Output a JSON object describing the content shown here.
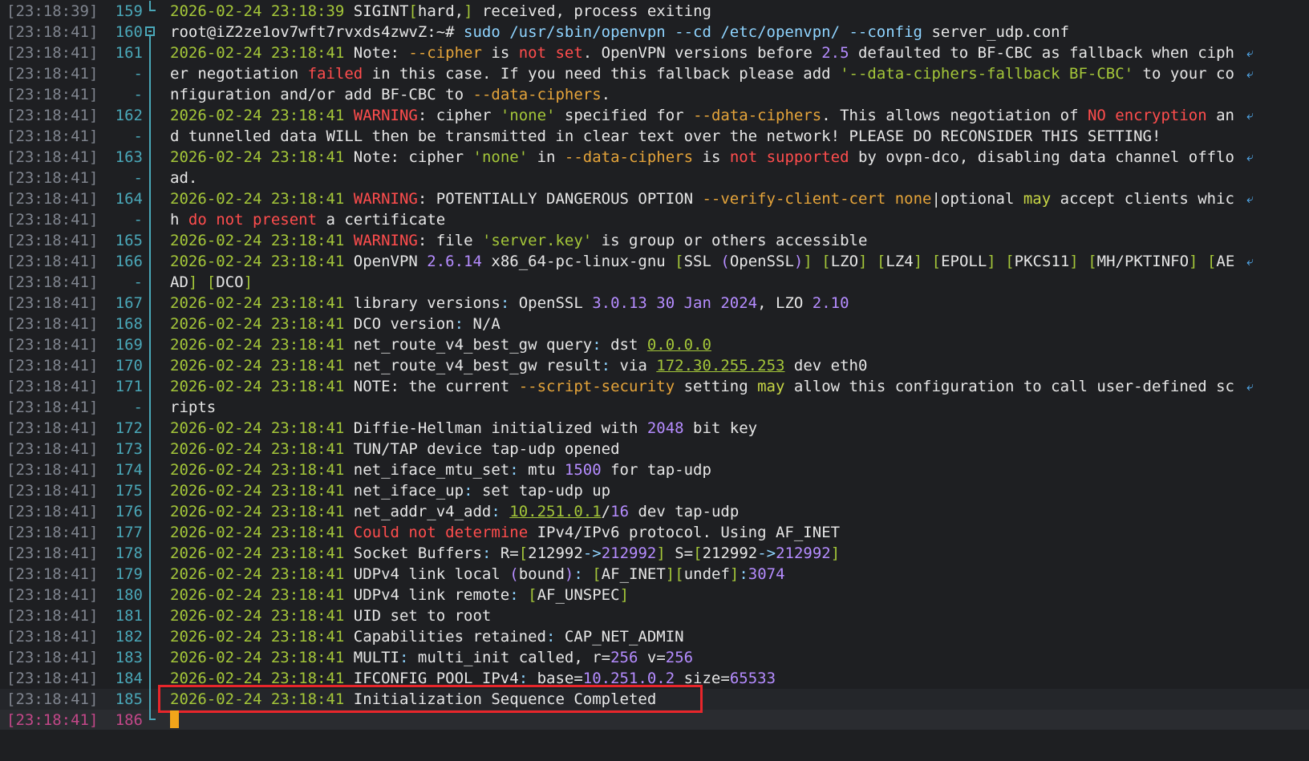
{
  "terminal": {
    "prompt_user": "root@iZ2ze1ov7wft7rvxds4zwvZ:~#",
    "rows": [
      {
        "ts": "[23:18:39]",
        "ln": "159",
        "gutter": "elbow",
        "segs": [
          [
            "date",
            "2026-02-24 23:18:39"
          ],
          [
            "plain",
            " SIGINT"
          ],
          [
            "br",
            "["
          ],
          [
            "plain",
            "hard,"
          ],
          [
            "br",
            "]"
          ],
          [
            "plain",
            " received, process exiting"
          ]
        ]
      },
      {
        "ts": "[23:18:41]",
        "ln": "160",
        "gutter": "fold",
        "segs": [
          [
            "plain",
            "root@iZ2ze1ov7wft7rvxds4zwvZ:~# "
          ],
          [
            "cmd",
            "sudo /usr/sbin/openvpn --cd /etc/openvpn/ --config"
          ],
          [
            "plain",
            " server_udp.conf"
          ]
        ]
      },
      {
        "ts": "[23:18:41]",
        "ln": "161",
        "gutter": "line",
        "wrap": true,
        "segs": [
          [
            "date",
            "2026-02-24 23:18:41"
          ],
          [
            "plain",
            " Note: "
          ],
          [
            "opt",
            "--cipher"
          ],
          [
            "plain",
            " is "
          ],
          [
            "kw",
            "not set"
          ],
          [
            "plain",
            ". OpenVPN versions before "
          ],
          [
            "num",
            "2.5"
          ],
          [
            "plain",
            " defaulted to BF-CBC as fallback when ciph"
          ]
        ]
      },
      {
        "ts": "[23:18:41]",
        "ln": "-",
        "gutter": "line",
        "wrap": true,
        "segs": [
          [
            "plain",
            "er negotiation "
          ],
          [
            "kw",
            "failed"
          ],
          [
            "plain",
            " in this case. If you need this fallback please add "
          ],
          [
            "str",
            "'--data-ciphers-fallback BF-CBC'"
          ],
          [
            "plain",
            " to your co"
          ]
        ]
      },
      {
        "ts": "[23:18:41]",
        "ln": "-",
        "gutter": "line",
        "segs": [
          [
            "plain",
            "nfiguration and/or add BF-CBC to "
          ],
          [
            "opt",
            "--data-ciphers"
          ],
          [
            "plain",
            "."
          ]
        ]
      },
      {
        "ts": "[23:18:41]",
        "ln": "162",
        "gutter": "line",
        "wrap": true,
        "segs": [
          [
            "date",
            "2026-02-24 23:18:41"
          ],
          [
            "plain",
            " "
          ],
          [
            "kw",
            "WARNING"
          ],
          [
            "plain",
            ": cipher "
          ],
          [
            "str",
            "'none'"
          ],
          [
            "plain",
            " specified for "
          ],
          [
            "opt",
            "--data-ciphers"
          ],
          [
            "plain",
            ". This allows negotiation of "
          ],
          [
            "kw",
            "NO encryption"
          ],
          [
            "plain",
            " an"
          ]
        ]
      },
      {
        "ts": "[23:18:41]",
        "ln": "-",
        "gutter": "line",
        "segs": [
          [
            "plain",
            "d tunnelled data WILL then be transmitted in clear text over the network! PLEASE DO RECONSIDER THIS SETTING!"
          ]
        ]
      },
      {
        "ts": "[23:18:41]",
        "ln": "163",
        "gutter": "line",
        "wrap": true,
        "segs": [
          [
            "date",
            "2026-02-24 23:18:41"
          ],
          [
            "plain",
            " Note: cipher "
          ],
          [
            "str",
            "'none'"
          ],
          [
            "plain",
            " in "
          ],
          [
            "opt",
            "--data-ciphers"
          ],
          [
            "plain",
            " is "
          ],
          [
            "kw",
            "not supported"
          ],
          [
            "plain",
            " by ovpn-dco, disabling data channel offlo"
          ]
        ]
      },
      {
        "ts": "[23:18:41]",
        "ln": "-",
        "gutter": "line",
        "segs": [
          [
            "plain",
            "ad."
          ]
        ]
      },
      {
        "ts": "[23:18:41]",
        "ln": "164",
        "gutter": "line",
        "wrap": true,
        "segs": [
          [
            "date",
            "2026-02-24 23:18:41"
          ],
          [
            "plain",
            " "
          ],
          [
            "kw",
            "WARNING"
          ],
          [
            "plain",
            ": POTENTIALLY DANGEROUS OPTION "
          ],
          [
            "opt",
            "--verify-client-cert none"
          ],
          [
            "plain",
            "|optional "
          ],
          [
            "yel",
            "may"
          ],
          [
            "plain",
            " accept clients whic"
          ]
        ]
      },
      {
        "ts": "[23:18:41]",
        "ln": "-",
        "gutter": "line",
        "segs": [
          [
            "plain",
            "h "
          ],
          [
            "kw",
            "do not present"
          ],
          [
            "plain",
            " a certificate"
          ]
        ]
      },
      {
        "ts": "[23:18:41]",
        "ln": "165",
        "gutter": "line",
        "segs": [
          [
            "date",
            "2026-02-24 23:18:41"
          ],
          [
            "plain",
            " "
          ],
          [
            "kw",
            "WARNING"
          ],
          [
            "plain",
            ": file "
          ],
          [
            "str",
            "'server.key'"
          ],
          [
            "plain",
            " is group or others accessible"
          ]
        ]
      },
      {
        "ts": "[23:18:41]",
        "ln": "166",
        "gutter": "line",
        "wrap": true,
        "segs": [
          [
            "date",
            "2026-02-24 23:18:41"
          ],
          [
            "plain",
            " OpenVPN "
          ],
          [
            "num",
            "2.6.14"
          ],
          [
            "plain",
            " x86_64-pc-linux-gnu "
          ],
          [
            "br",
            "["
          ],
          [
            "plain",
            "SSL "
          ],
          [
            "num",
            "("
          ],
          [
            "plain",
            "OpenSSL"
          ],
          [
            "num",
            ")"
          ],
          [
            "br",
            "]"
          ],
          [
            "plain",
            " "
          ],
          [
            "br",
            "["
          ],
          [
            "plain",
            "LZO"
          ],
          [
            "br",
            "]"
          ],
          [
            "plain",
            " "
          ],
          [
            "br",
            "["
          ],
          [
            "plain",
            "LZ4"
          ],
          [
            "br",
            "]"
          ],
          [
            "plain",
            " "
          ],
          [
            "br",
            "["
          ],
          [
            "plain",
            "EPOLL"
          ],
          [
            "br",
            "]"
          ],
          [
            "plain",
            " "
          ],
          [
            "br",
            "["
          ],
          [
            "plain",
            "PKCS11"
          ],
          [
            "br",
            "]"
          ],
          [
            "plain",
            " "
          ],
          [
            "br",
            "["
          ],
          [
            "plain",
            "MH/PKTINFO"
          ],
          [
            "br",
            "]"
          ],
          [
            "plain",
            " "
          ],
          [
            "br",
            "["
          ],
          [
            "plain",
            "AE"
          ]
        ]
      },
      {
        "ts": "[23:18:41]",
        "ln": "-",
        "gutter": "line",
        "segs": [
          [
            "plain",
            "AD"
          ],
          [
            "br",
            "]"
          ],
          [
            "plain",
            " "
          ],
          [
            "br",
            "["
          ],
          [
            "plain",
            "DCO"
          ],
          [
            "br",
            "]"
          ]
        ]
      },
      {
        "ts": "[23:18:41]",
        "ln": "167",
        "gutter": "line",
        "segs": [
          [
            "date",
            "2026-02-24 23:18:41"
          ],
          [
            "plain",
            " library versions"
          ],
          [
            "op",
            ":"
          ],
          [
            "plain",
            " OpenSSL "
          ],
          [
            "num",
            "3.0.13 30 Jan 2024"
          ],
          [
            "plain",
            ", LZO "
          ],
          [
            "num",
            "2.10"
          ]
        ]
      },
      {
        "ts": "[23:18:41]",
        "ln": "168",
        "gutter": "line",
        "segs": [
          [
            "date",
            "2026-02-24 23:18:41"
          ],
          [
            "plain",
            " DCO version"
          ],
          [
            "op",
            ":"
          ],
          [
            "plain",
            " N/A"
          ]
        ]
      },
      {
        "ts": "[23:18:41]",
        "ln": "169",
        "gutter": "line",
        "segs": [
          [
            "date",
            "2026-02-24 23:18:41"
          ],
          [
            "plain",
            " net_route_v4_best_gw query"
          ],
          [
            "op",
            ":"
          ],
          [
            "plain",
            " dst "
          ],
          [
            "ip",
            "0.0.0.0"
          ]
        ]
      },
      {
        "ts": "[23:18:41]",
        "ln": "170",
        "gutter": "line",
        "segs": [
          [
            "date",
            "2026-02-24 23:18:41"
          ],
          [
            "plain",
            " net_route_v4_best_gw result"
          ],
          [
            "op",
            ":"
          ],
          [
            "plain",
            " via "
          ],
          [
            "ip",
            "172.30.255.253"
          ],
          [
            "plain",
            " dev eth0"
          ]
        ]
      },
      {
        "ts": "[23:18:41]",
        "ln": "171",
        "gutter": "line",
        "wrap": true,
        "segs": [
          [
            "date",
            "2026-02-24 23:18:41"
          ],
          [
            "plain",
            " NOTE: the current "
          ],
          [
            "opt",
            "--script-security"
          ],
          [
            "plain",
            " setting "
          ],
          [
            "yel",
            "may"
          ],
          [
            "plain",
            " allow this configuration to call user-defined sc"
          ]
        ]
      },
      {
        "ts": "[23:18:41]",
        "ln": "-",
        "gutter": "line",
        "segs": [
          [
            "plain",
            "ripts"
          ]
        ]
      },
      {
        "ts": "[23:18:41]",
        "ln": "172",
        "gutter": "line",
        "segs": [
          [
            "date",
            "2026-02-24 23:18:41"
          ],
          [
            "plain",
            " Diffie-Hellman initialized with "
          ],
          [
            "num",
            "2048"
          ],
          [
            "plain",
            " bit key"
          ]
        ]
      },
      {
        "ts": "[23:18:41]",
        "ln": "173",
        "gutter": "line",
        "segs": [
          [
            "date",
            "2026-02-24 23:18:41"
          ],
          [
            "plain",
            " TUN/TAP device tap-udp opened"
          ]
        ]
      },
      {
        "ts": "[23:18:41]",
        "ln": "174",
        "gutter": "line",
        "segs": [
          [
            "date",
            "2026-02-24 23:18:41"
          ],
          [
            "plain",
            " net_iface_mtu_set"
          ],
          [
            "op",
            ":"
          ],
          [
            "plain",
            " mtu "
          ],
          [
            "num",
            "1500"
          ],
          [
            "plain",
            " for tap-udp"
          ]
        ]
      },
      {
        "ts": "[23:18:41]",
        "ln": "175",
        "gutter": "line",
        "segs": [
          [
            "date",
            "2026-02-24 23:18:41"
          ],
          [
            "plain",
            " net_iface_up"
          ],
          [
            "op",
            ":"
          ],
          [
            "plain",
            " set tap-udp up"
          ]
        ]
      },
      {
        "ts": "[23:18:41]",
        "ln": "176",
        "gutter": "line",
        "segs": [
          [
            "date",
            "2026-02-24 23:18:41"
          ],
          [
            "plain",
            " net_addr_v4_add"
          ],
          [
            "op",
            ":"
          ],
          [
            "plain",
            " "
          ],
          [
            "ip",
            "10.251.0.1"
          ],
          [
            "plain",
            "/"
          ],
          [
            "num",
            "16"
          ],
          [
            "plain",
            " dev tap-udp"
          ]
        ]
      },
      {
        "ts": "[23:18:41]",
        "ln": "177",
        "gutter": "line",
        "segs": [
          [
            "date",
            "2026-02-24 23:18:41"
          ],
          [
            "plain",
            " "
          ],
          [
            "kw",
            "Could not determine"
          ],
          [
            "plain",
            " IPv4/IPv6 protocol. Using AF_INET"
          ]
        ]
      },
      {
        "ts": "[23:18:41]",
        "ln": "178",
        "gutter": "line",
        "segs": [
          [
            "date",
            "2026-02-24 23:18:41"
          ],
          [
            "plain",
            " Socket Buffers"
          ],
          [
            "op",
            ":"
          ],
          [
            "plain",
            " R="
          ],
          [
            "br",
            "["
          ],
          [
            "plain",
            "212992"
          ],
          [
            "op",
            "->"
          ],
          [
            "num",
            "212992"
          ],
          [
            "br",
            "]"
          ],
          [
            "plain",
            " S="
          ],
          [
            "br",
            "["
          ],
          [
            "plain",
            "212992"
          ],
          [
            "op",
            "->"
          ],
          [
            "num",
            "212992"
          ],
          [
            "br",
            "]"
          ]
        ]
      },
      {
        "ts": "[23:18:41]",
        "ln": "179",
        "gutter": "line",
        "segs": [
          [
            "date",
            "2026-02-24 23:18:41"
          ],
          [
            "plain",
            " UDPv4 link local "
          ],
          [
            "num",
            "("
          ],
          [
            "plain",
            "bound"
          ],
          [
            "num",
            ")"
          ],
          [
            "op",
            ":"
          ],
          [
            "plain",
            " "
          ],
          [
            "br",
            "["
          ],
          [
            "plain",
            "AF_INET"
          ],
          [
            "br",
            "]["
          ],
          [
            "plain",
            "undef"
          ],
          [
            "br",
            "]"
          ],
          [
            "op",
            ":"
          ],
          [
            "num",
            "3074"
          ]
        ]
      },
      {
        "ts": "[23:18:41]",
        "ln": "180",
        "gutter": "line",
        "segs": [
          [
            "date",
            "2026-02-24 23:18:41"
          ],
          [
            "plain",
            " UDPv4 link remote"
          ],
          [
            "op",
            ":"
          ],
          [
            "plain",
            " "
          ],
          [
            "br",
            "["
          ],
          [
            "plain",
            "AF_UNSPEC"
          ],
          [
            "br",
            "]"
          ]
        ]
      },
      {
        "ts": "[23:18:41]",
        "ln": "181",
        "gutter": "line",
        "segs": [
          [
            "date",
            "2026-02-24 23:18:41"
          ],
          [
            "plain",
            " UID set to root"
          ]
        ]
      },
      {
        "ts": "[23:18:41]",
        "ln": "182",
        "gutter": "line",
        "segs": [
          [
            "date",
            "2026-02-24 23:18:41"
          ],
          [
            "plain",
            " Capabilities retained"
          ],
          [
            "op",
            ":"
          ],
          [
            "plain",
            " CAP_NET_ADMIN"
          ]
        ]
      },
      {
        "ts": "[23:18:41]",
        "ln": "183",
        "gutter": "line",
        "segs": [
          [
            "date",
            "2026-02-24 23:18:41"
          ],
          [
            "plain",
            " MULTI"
          ],
          [
            "op",
            ":"
          ],
          [
            "plain",
            " multi_init called, r="
          ],
          [
            "num",
            "256"
          ],
          [
            "plain",
            " v="
          ],
          [
            "num",
            "256"
          ]
        ]
      },
      {
        "ts": "[23:18:41]",
        "ln": "184",
        "gutter": "line",
        "segs": [
          [
            "date",
            "2026-02-24 23:18:41"
          ],
          [
            "plain",
            " IFCONFIG POOL IPv4"
          ],
          [
            "op",
            ":"
          ],
          [
            "plain",
            " base="
          ],
          [
            "num",
            "10.251.0.2"
          ],
          [
            "plain",
            " size="
          ],
          [
            "num",
            "65533"
          ]
        ]
      },
      {
        "ts": "[23:18:41]",
        "ln": "185",
        "gutter": "line",
        "state": "prev",
        "segs": [
          [
            "date",
            "2026-02-24 23:18:41"
          ],
          [
            "plain",
            " Initialization Sequence Completed"
          ]
        ]
      },
      {
        "ts": "[23:18:41]",
        "ln": "186",
        "gutter": "elbow",
        "state": "current",
        "segs": []
      }
    ]
  },
  "colors": {
    "background": "#1e1f22",
    "highlight_box": "#e8262b",
    "cursor": "#f2a51a",
    "timestamp": "#7f848e",
    "line_number": "#4aa7b8",
    "current_line": "#c24788"
  },
  "icons": {
    "wrap_mark": "wrap-arrow-icon",
    "fold": "fold-collapse-icon"
  }
}
